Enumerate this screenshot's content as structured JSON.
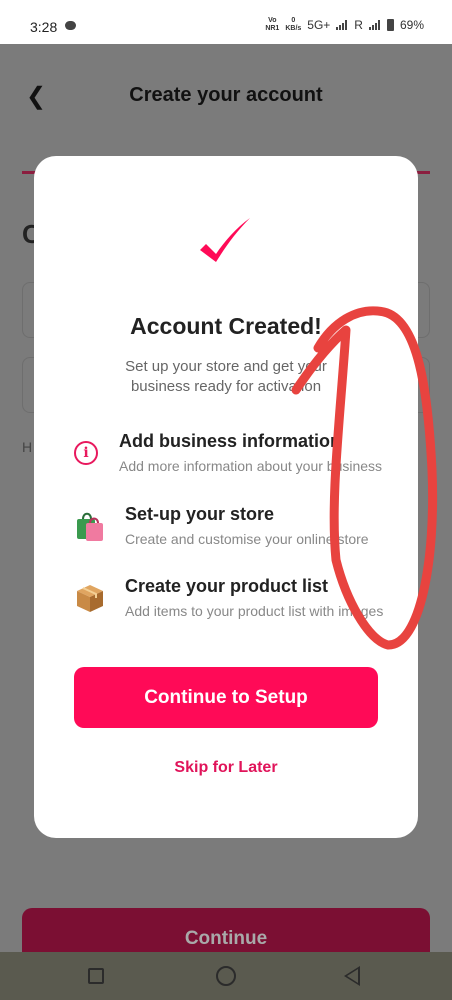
{
  "status_bar": {
    "time": "3:28",
    "volte_label": "Vo\nNR1",
    "speed_label": "0\nKB/s",
    "network": "5G+",
    "roaming": "R",
    "battery": "69%"
  },
  "header": {
    "title": "Create your account"
  },
  "background_form": {
    "heading_initial": "C",
    "hint_initial": "H",
    "continue_label": "Continue"
  },
  "modal": {
    "title": "Account Created!",
    "subtitle": "Set up your store and get your business ready for activation",
    "tasks": [
      {
        "title": "Add business information",
        "description": "Add more information about your business",
        "icon": "info-icon"
      },
      {
        "title": "Set-up your store",
        "description": "Create and customise your online store",
        "icon": "shopping-bag-icon"
      },
      {
        "title": "Create your product list",
        "description": "Add items to your product list with images",
        "icon": "package-icon"
      }
    ],
    "primary_button": "Continue to Setup",
    "secondary_button": "Skip for Later"
  },
  "colors": {
    "accent": "#ff0a57",
    "annotation": "#e8433f"
  }
}
